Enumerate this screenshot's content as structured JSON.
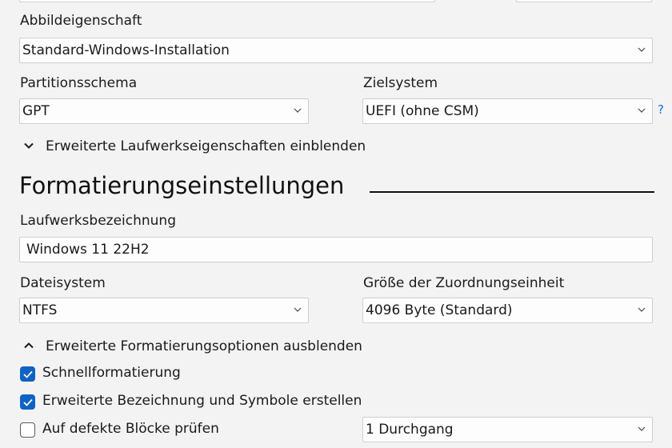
{
  "image_option": {
    "label": "Abbildeigenschaft",
    "value": "Standard-Windows-Installation"
  },
  "partition_scheme": {
    "label": "Partitionsschema",
    "value": "GPT"
  },
  "target_system": {
    "label": "Zielsystem",
    "value": "UEFI (ohne CSM)",
    "help": "?"
  },
  "advanced_drive_toggle": "Erweiterte Laufwerkseigenschaften einblenden",
  "format_section": {
    "title": "Formatierungseinstellungen"
  },
  "volume_label": {
    "label": "Laufwerksbezeichnung",
    "value": "Windows 11 22H2"
  },
  "filesystem": {
    "label": "Dateisystem",
    "value": "NTFS"
  },
  "cluster_size": {
    "label": "Größe der Zuordnungseinheit",
    "value": "4096 Byte (Standard)"
  },
  "advanced_format_toggle": "Erweiterte Formatierungsoptionen ausblenden",
  "options": {
    "quick_format": {
      "label": "Schnellformatierung",
      "checked": true
    },
    "extended_label": {
      "label": "Erweiterte Bezeichnung und Symbole erstellen",
      "checked": true
    },
    "bad_blocks": {
      "label": "Auf defekte Blöcke prüfen",
      "checked": false
    }
  },
  "passes": {
    "value": "1 Durchgang"
  },
  "colors": {
    "accent": "#0f63c4",
    "help": "#1a6ed8",
    "background": "#f3f3f3"
  }
}
